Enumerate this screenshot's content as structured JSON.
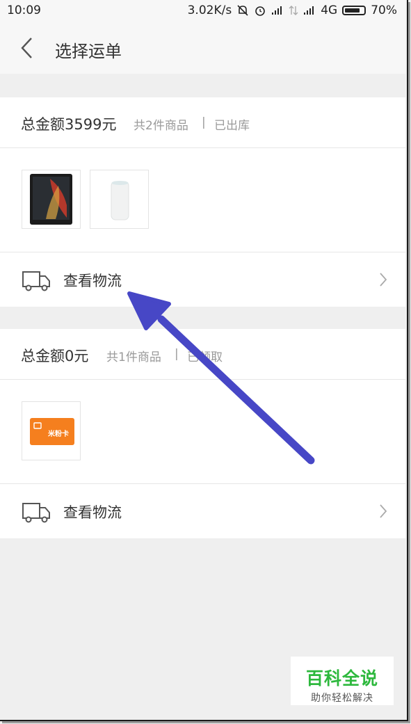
{
  "status_bar": {
    "time": "10:09",
    "speed": "3.02K/s",
    "network": "4G",
    "battery": "70%"
  },
  "header": {
    "title": "选择运单"
  },
  "orders": [
    {
      "total": "总金额3599元",
      "count": "共2件商品",
      "separator": "|",
      "status": "已出库",
      "products": [
        "phone",
        "speaker"
      ],
      "logistics_label": "查看物流"
    },
    {
      "total": "总金额0元",
      "count": "共1件商品",
      "separator": "|",
      "status": "已领取",
      "products": [
        "sim-card"
      ],
      "sim_card_text": "米粉卡",
      "logistics_label": "查看物流"
    }
  ],
  "watermark": {
    "main": "百科全说",
    "sub": "助你轻松解决"
  },
  "colors": {
    "arrow": "#4747c6",
    "watermark_green": "#2db83d"
  }
}
